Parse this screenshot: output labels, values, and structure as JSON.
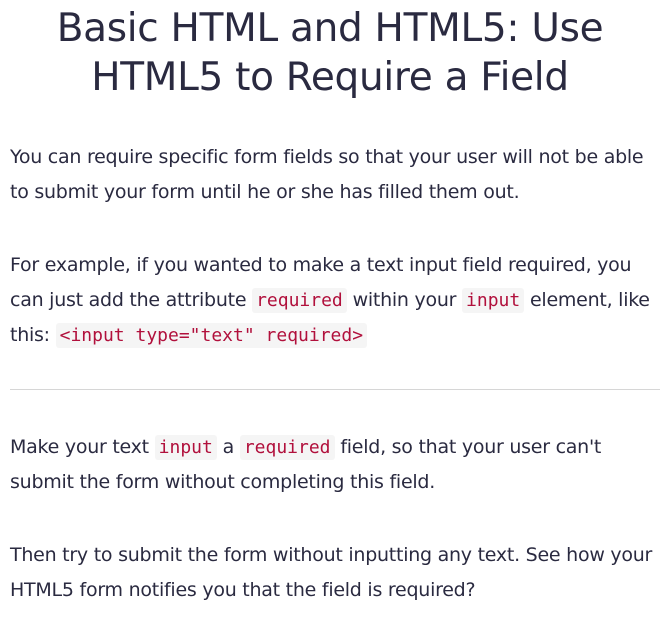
{
  "title": {
    "line1": "Basic HTML and HTML5: Use",
    "line2": "HTML5 to Require a Field"
  },
  "paragraph1": {
    "text": "You can require specific form fields so that your user will not be able to submit your form until he or she has filled them out."
  },
  "paragraph2": {
    "text_a": "For example, if you wanted to make a text input field required, you can just add the attribute ",
    "code_required": "required",
    "text_b": " within your ",
    "code_input": "input",
    "text_c": " element, like this: ",
    "code_example": "<input type=\"text\" required>"
  },
  "paragraph3": {
    "text_a": "Make your text ",
    "code_input": "input",
    "text_b": " a ",
    "code_required": "required",
    "text_c": " field, so that your user can't submit the form without completing this field."
  },
  "paragraph4": {
    "text": "Then try to submit the form without inputting any text. See how your HTML5 form notifies you that the field is required?"
  },
  "colors": {
    "text": "#2a2a40",
    "code_text": "#b1103c",
    "code_background": "#f5f5f5",
    "divider": "#d6d6d6"
  }
}
